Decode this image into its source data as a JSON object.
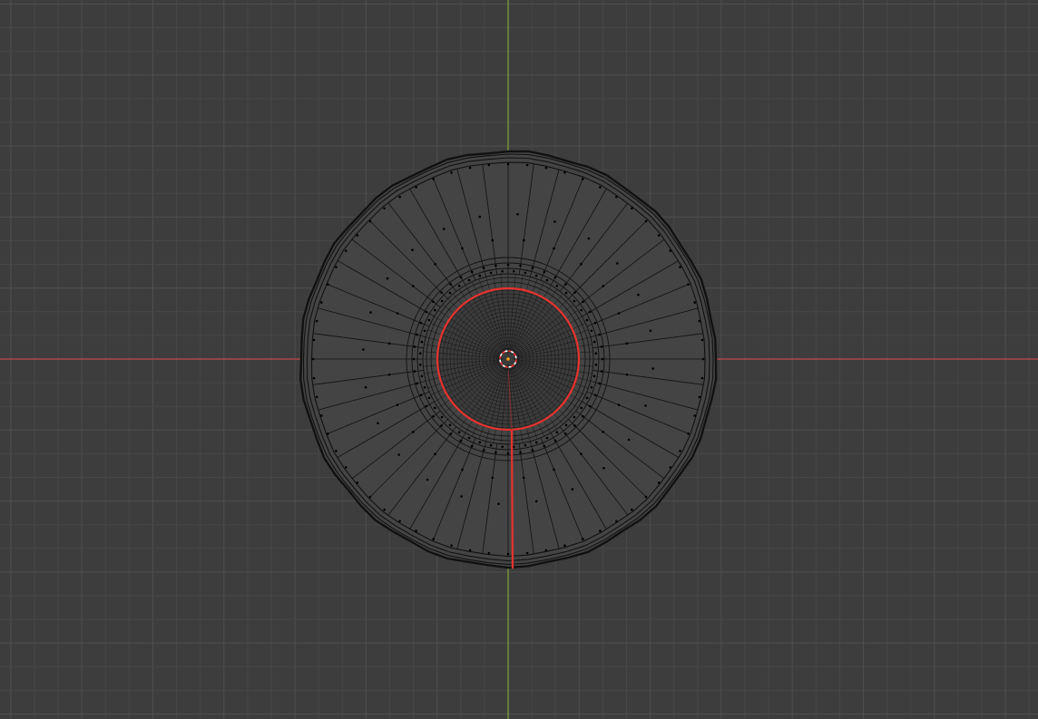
{
  "viewport": {
    "view": "top-orthographic",
    "mode": "edit-mode-wireframe",
    "grid_visible": true,
    "axis_x_visible": true,
    "axis_y_visible": true
  },
  "mesh": {
    "shape": "disc",
    "selected_edge_loop": "inner-ring",
    "selected_seam": "vertical-spoke-below-center"
  },
  "colors": {
    "background": "#3d3d3d",
    "grid_minor": "#474747",
    "grid_major": "#4f4f4f",
    "axis_x": "#c4474d",
    "axis_y": "#7da035",
    "wire": "#111111",
    "vertex": "#000000",
    "selected": "#e8322d",
    "cursor_red": "#ff3030",
    "cursor_white": "#ffffff"
  },
  "icons": {
    "cursor": "3d-cursor-icon",
    "origin": "object-origin-icon"
  }
}
